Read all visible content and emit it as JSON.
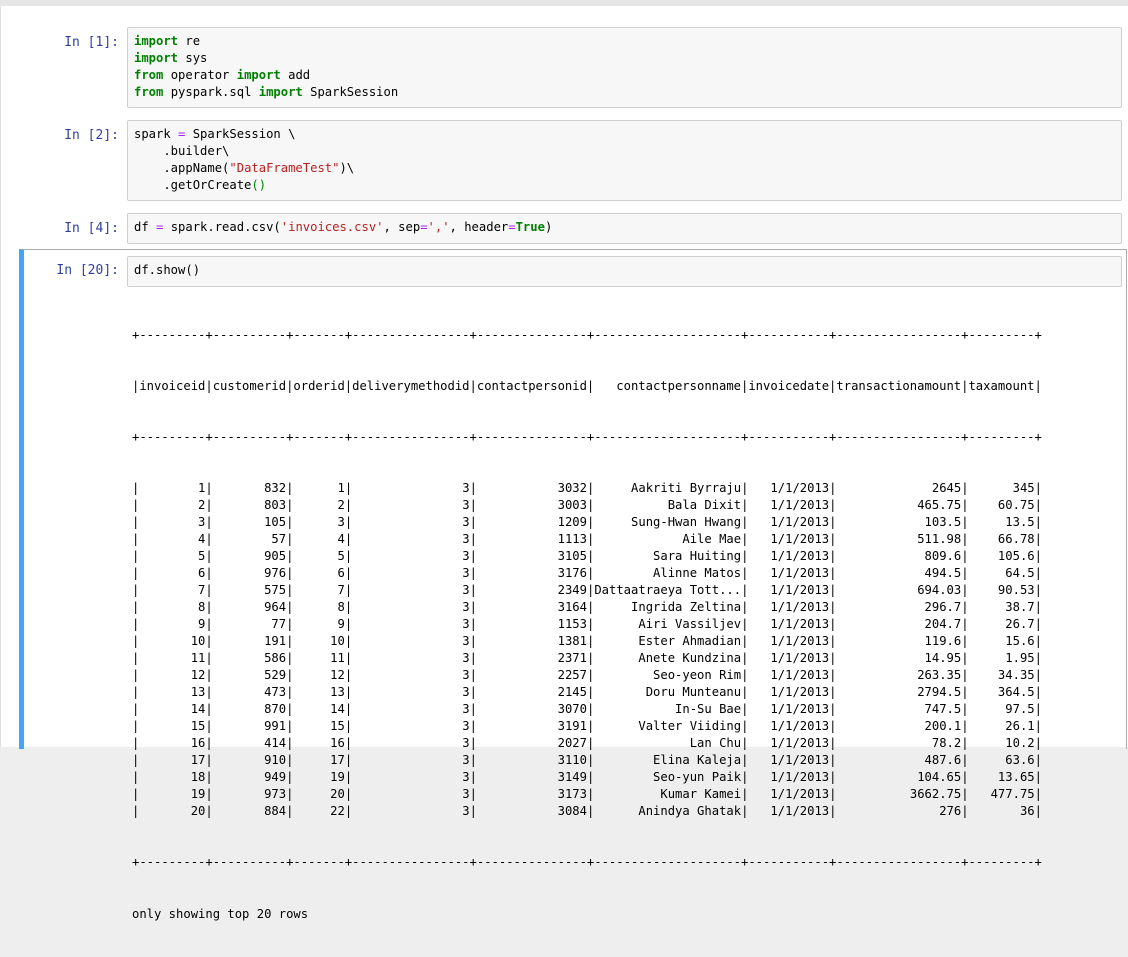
{
  "cells": [
    {
      "prompt": "In [1]:",
      "lines": [
        [
          {
            "t": "import",
            "c": "kw"
          },
          {
            "t": " re"
          }
        ],
        [
          {
            "t": "import",
            "c": "kw"
          },
          {
            "t": " sys"
          }
        ],
        [
          {
            "t": "from",
            "c": "kw"
          },
          {
            "t": " operator "
          },
          {
            "t": "import",
            "c": "kw"
          },
          {
            "t": " add"
          }
        ],
        [
          {
            "t": "from",
            "c": "kw"
          },
          {
            "t": " pyspark.sql "
          },
          {
            "t": "import",
            "c": "kw"
          },
          {
            "t": " SparkSession"
          }
        ]
      ]
    },
    {
      "prompt": "In [2]:",
      "lines": [
        [
          {
            "t": "spark "
          },
          {
            "t": "=",
            "c": "op"
          },
          {
            "t": " SparkSession \\"
          }
        ],
        [
          {
            "t": "    .builder\\"
          }
        ],
        [
          {
            "t": "    .appName("
          },
          {
            "t": "\"DataFrameTest\"",
            "c": "str"
          },
          {
            "t": ")\\"
          }
        ],
        [
          {
            "t": "    .getOrCreate"
          },
          {
            "t": "()",
            "c": "paren"
          }
        ]
      ]
    },
    {
      "prompt": "In [4]:",
      "lines": [
        [
          {
            "t": "df "
          },
          {
            "t": "=",
            "c": "op"
          },
          {
            "t": " spark.read.csv("
          },
          {
            "t": "'invoices.csv'",
            "c": "str"
          },
          {
            "t": ", sep"
          },
          {
            "t": "=",
            "c": "op"
          },
          {
            "t": "','",
            "c": "str"
          },
          {
            "t": ", header"
          },
          {
            "t": "=",
            "c": "op"
          },
          {
            "t": "True",
            "c": "kw"
          },
          {
            "t": ")"
          }
        ]
      ]
    },
    {
      "prompt": "In [20]:",
      "lines": [
        [
          {
            "t": "df.show()"
          }
        ]
      ]
    }
  ],
  "output": {
    "separator": "+---------+----------+-------+----------------+---------------+--------------------+-----------+-----------------+---------+",
    "header": "|invoiceid|customerid|orderid|deliverymethodid|contactpersonid|   contactpersonname|invoicedate|transactionamount|taxamount|",
    "columns": [
      "invoiceid",
      "customerid",
      "orderid",
      "deliverymethodid",
      "contactpersonid",
      "contactpersonname",
      "invoicedate",
      "transactionamount",
      "taxamount"
    ],
    "rows": [
      [
        "1",
        "832",
        "1",
        "3",
        "3032",
        "Aakriti Byrraju",
        "1/1/2013",
        "2645",
        "345"
      ],
      [
        "2",
        "803",
        "2",
        "3",
        "3003",
        "Bala Dixit",
        "1/1/2013",
        "465.75",
        "60.75"
      ],
      [
        "3",
        "105",
        "3",
        "3",
        "1209",
        "Sung-Hwan Hwang",
        "1/1/2013",
        "103.5",
        "13.5"
      ],
      [
        "4",
        "57",
        "4",
        "3",
        "1113",
        "Aile Mae",
        "1/1/2013",
        "511.98",
        "66.78"
      ],
      [
        "5",
        "905",
        "5",
        "3",
        "3105",
        "Sara Huiting",
        "1/1/2013",
        "809.6",
        "105.6"
      ],
      [
        "6",
        "976",
        "6",
        "3",
        "3176",
        "Alinne Matos",
        "1/1/2013",
        "494.5",
        "64.5"
      ],
      [
        "7",
        "575",
        "7",
        "3",
        "2349",
        "Dattaatraeya Tott...",
        "1/1/2013",
        "694.03",
        "90.53"
      ],
      [
        "8",
        "964",
        "8",
        "3",
        "3164",
        "Ingrida Zeltina",
        "1/1/2013",
        "296.7",
        "38.7"
      ],
      [
        "9",
        "77",
        "9",
        "3",
        "1153",
        "Airi Vassiljev",
        "1/1/2013",
        "204.7",
        "26.7"
      ],
      [
        "10",
        "191",
        "10",
        "3",
        "1381",
        "Ester Ahmadian",
        "1/1/2013",
        "119.6",
        "15.6"
      ],
      [
        "11",
        "586",
        "11",
        "3",
        "2371",
        "Anete Kundzina",
        "1/1/2013",
        "14.95",
        "1.95"
      ],
      [
        "12",
        "529",
        "12",
        "3",
        "2257",
        "Seo-yeon Rim",
        "1/1/2013",
        "263.35",
        "34.35"
      ],
      [
        "13",
        "473",
        "13",
        "3",
        "2145",
        "Doru Munteanu",
        "1/1/2013",
        "2794.5",
        "364.5"
      ],
      [
        "14",
        "870",
        "14",
        "3",
        "3070",
        "In-Su Bae",
        "1/1/2013",
        "747.5",
        "97.5"
      ],
      [
        "15",
        "991",
        "15",
        "3",
        "3191",
        "Valter Viiding",
        "1/1/2013",
        "200.1",
        "26.1"
      ],
      [
        "16",
        "414",
        "16",
        "3",
        "2027",
        "Lan Chu",
        "1/1/2013",
        "78.2",
        "10.2"
      ],
      [
        "17",
        "910",
        "17",
        "3",
        "3110",
        "Elina Kaleja",
        "1/1/2013",
        "487.6",
        "63.6"
      ],
      [
        "18",
        "949",
        "19",
        "3",
        "3149",
        "Seo-yun Paik",
        "1/1/2013",
        "104.65",
        "13.65"
      ],
      [
        "19",
        "973",
        "20",
        "3",
        "3173",
        "Kumar Kamei",
        "1/1/2013",
        "3662.75",
        "477.75"
      ],
      [
        "20",
        "884",
        "22",
        "3",
        "3084",
        "Anindya Ghatak",
        "1/1/2013",
        "276",
        "36"
      ]
    ],
    "footer": "only showing top 20 rows"
  }
}
